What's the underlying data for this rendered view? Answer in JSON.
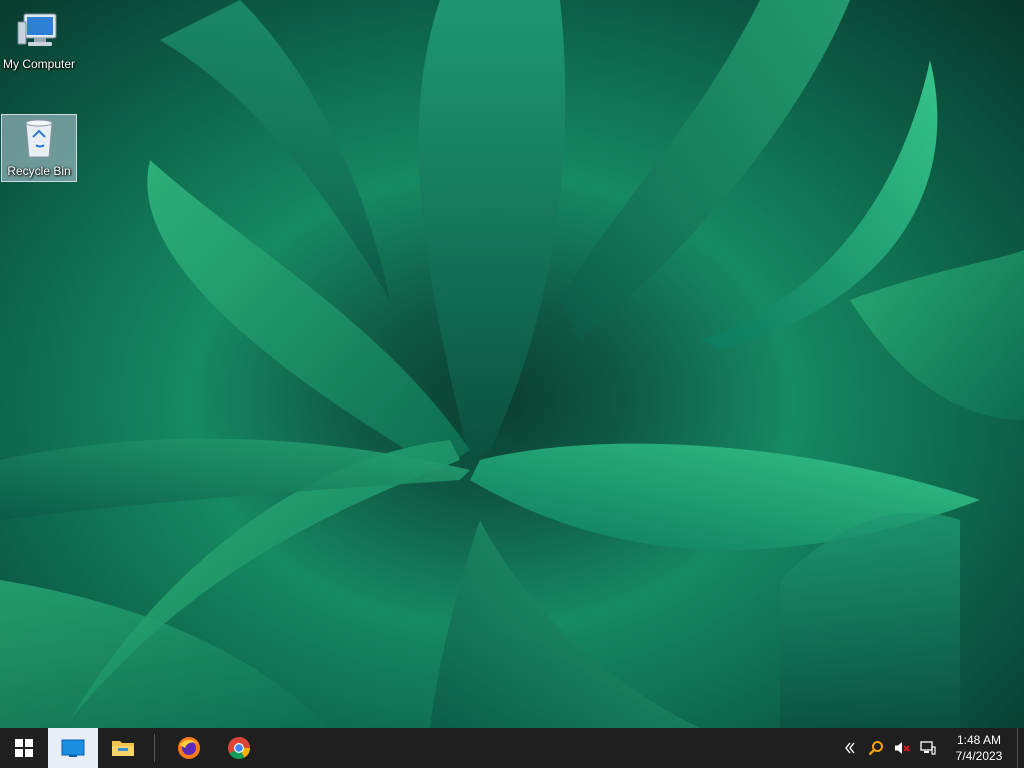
{
  "desktop": {
    "icons": [
      {
        "label": "My Computer",
        "icon": "computer-icon"
      },
      {
        "label": "Recycle Bin",
        "icon": "recycle-bin-icon",
        "selected": true
      }
    ]
  },
  "taskbar": {
    "start": {
      "icon": "windows-start-icon"
    },
    "pinned": [
      {
        "icon": "task-view-icon",
        "active": true
      },
      {
        "icon": "file-explorer-icon"
      },
      {
        "icon": "firefox-icon"
      },
      {
        "icon": "chrome-icon"
      }
    ],
    "tray": {
      "icons": [
        "chevron-left-icon",
        "search-icon",
        "volume-muted-icon",
        "network-icon"
      ],
      "time": "1:48 AM",
      "date": "7/4/2023"
    }
  },
  "colors": {
    "taskbar_bg": "#1f1f1f",
    "active_button_bg": "#e7eef8",
    "wallpaper_primary": "#168a63",
    "wallpaper_dark": "#0a3d2e",
    "accent": "#0078d7"
  }
}
